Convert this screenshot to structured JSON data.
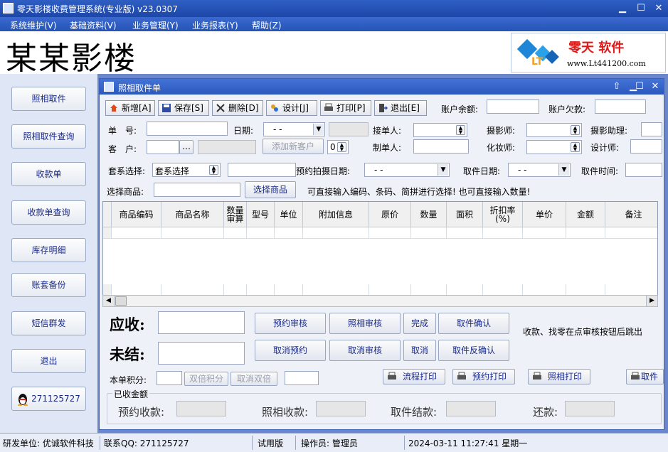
{
  "window": {
    "title": "零天影楼收费管理系统(专业版)  v23.0307"
  },
  "menu": [
    "系统维护(V)",
    "基础资料(V)",
    "业务管理(Y)",
    "业务报表(Y)",
    "帮助(Z)"
  ],
  "banner": {
    "title": "某某影楼",
    "logo_text": "零天 软件",
    "logo_url": "www.Lt441200.com"
  },
  "sidebar": [
    {
      "label": "照相取件"
    },
    {
      "label": "照相取件查询"
    },
    {
      "label": "收款单"
    },
    {
      "label": "收款单查询"
    },
    {
      "label": "库存明细"
    },
    {
      "label": "账套备份"
    },
    {
      "label": "短信群发"
    },
    {
      "label": "退出"
    },
    {
      "label": "271125727"
    }
  ],
  "child": {
    "title": "照相取件单",
    "toolbar": [
      "新增[A]",
      "保存[S]",
      "删除[D]",
      "设计[J]",
      "打印[P]",
      "退出[E]"
    ],
    "balance_label": "账户余额:",
    "debt_label": "账户欠款:",
    "form": {
      "order_no": "单　号:",
      "date": "日期:",
      "date_value": "-  -",
      "receiver": "接单人:",
      "photographer": "摄影师:",
      "photo_assistant": "摄影助理:",
      "customer": "客　户:",
      "add_customer": "添加新客户",
      "spin_value": "0",
      "maker": "制单人:",
      "makeup": "化妆师:",
      "designer": "设计师:",
      "package_label": "套系选择:",
      "package_value": "套系选择",
      "book_date": "预约拍摄日期:",
      "book_date_value": "-  -",
      "pickup_date": "取件日期:",
      "pickup_date_value": "-  -",
      "pickup_time": "取件时间:",
      "select_goods": "选择商品:",
      "select_goods_button": "选择商品",
      "hint": "可直接输入编码、条码、简拼进行选择! 也可直接输入数量!"
    },
    "grid_headers": [
      "商品编码",
      "商品名称",
      "数量\n审算",
      "型号",
      "单位",
      "附加信息",
      "原价",
      "数量",
      "面积",
      "折扣率\n(%)",
      "单价",
      "金额",
      "备注"
    ],
    "summary": {
      "receivable": "应收:",
      "unsettled": "未结:",
      "points": "本单积分:",
      "double_points": "双倍积分",
      "cancel_double": "取消双倍",
      "note": "收款、找零在点审核按钮后跳出",
      "received_group": "已收金额",
      "book_received": "预约收款:",
      "photo_received": "照相收款:",
      "pickup_settled": "取件结款:",
      "repay": "还款:"
    },
    "actions_row1": [
      "预约审核",
      "照相审核",
      "完成",
      "取件确认"
    ],
    "actions_row2": [
      "取消预约",
      "取消审核",
      "取消",
      "取件反确认"
    ],
    "print_buttons": [
      "流程打印",
      "预约打印",
      "照相打印",
      "取件"
    ]
  },
  "status": {
    "developer": "研发单位: 优诚软件科技",
    "qq": "联系QQ:  271125727",
    "edition": "试用版",
    "operator": "操作员: 管理员",
    "datetime": "2024-03-11 11:27:41 星期一"
  }
}
